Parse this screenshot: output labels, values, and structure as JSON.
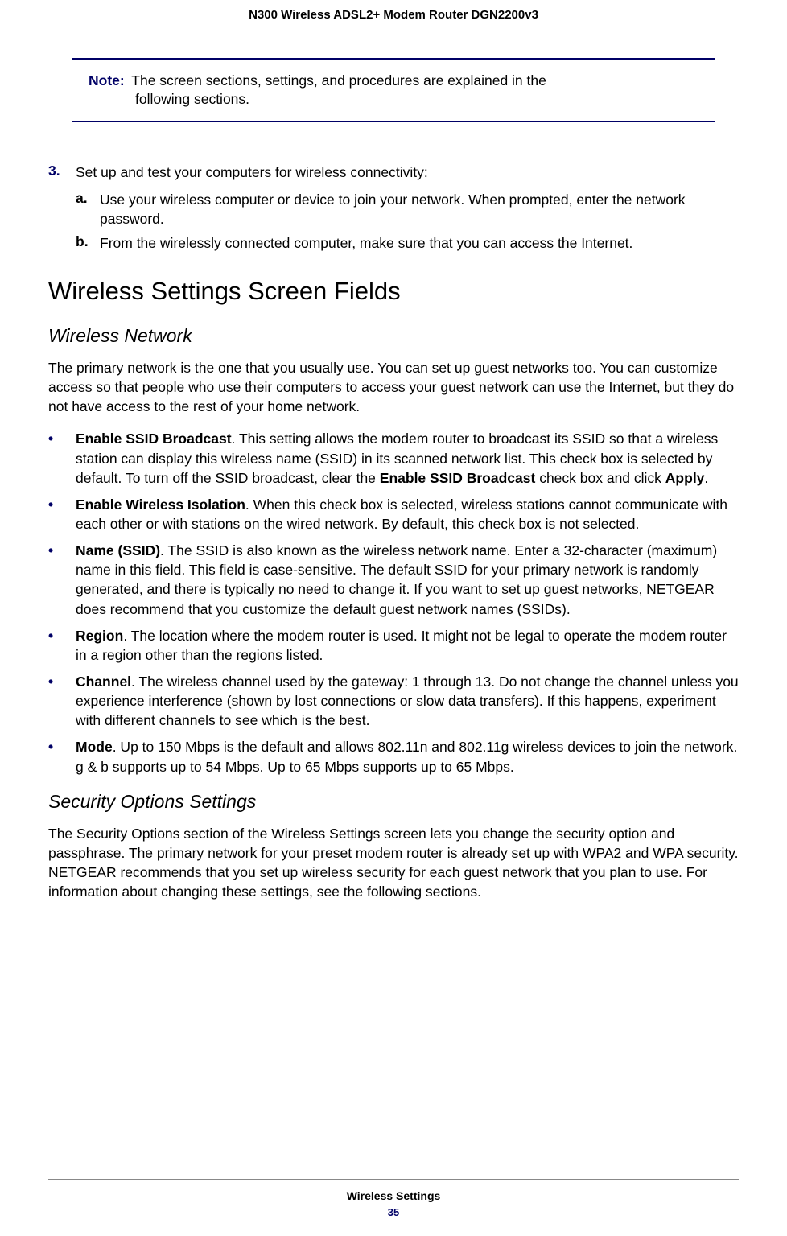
{
  "header": {
    "title": "N300 Wireless ADSL2+ Modem Router DGN2200v3"
  },
  "note": {
    "label": "Note:",
    "line1": "The screen sections, settings, and procedures are explained in the",
    "line2": "following sections."
  },
  "step3": {
    "number": "3.",
    "text": "Set up and test your computers for wireless connectivity:",
    "sub_a": {
      "label": "a.",
      "text": "Use your wireless computer or device to join your network. When prompted, enter the network password."
    },
    "sub_b": {
      "label": "b.",
      "text": "From the wirelessly connected computer, make sure that you can access the Internet."
    }
  },
  "h1": "Wireless Settings Screen Fields",
  "wireless_network": {
    "heading": "Wireless Network",
    "intro": "The primary network is the one that you usually use. You can set up guest networks too. You can customize access so that people who use their computers to access your guest network can use the Internet, but they do not have access to the rest of your home network.",
    "bullets": {
      "ssid_broadcast": {
        "bold1": "Enable SSID Broadcast",
        "text1": ". This setting allows the modem router to broadcast its SSID so that a wireless station can display this wireless name (SSID) in its scanned network list. This check box is selected by default. To turn off the SSID broadcast, clear the ",
        "bold2": "Enable SSID Broadcast",
        "text2": " check box and click ",
        "bold3": "Apply",
        "text3": "."
      },
      "wireless_isolation": {
        "bold": "Enable Wireless Isolation",
        "text": ". When this check box is selected, wireless stations cannot communicate with each other or with stations on the wired network. By default, this check box is not selected."
      },
      "name_ssid": {
        "bold": "Name (SSID)",
        "text": ". The SSID is also known as the wireless network name. Enter a 32-character (maximum) name in this field. This field is case-sensitive. The default SSID for your primary network is randomly generated, and there is typically no need to change it. If you want to set up guest networks, NETGEAR does recommend that you customize the default guest network names (SSIDs)."
      },
      "region": {
        "bold": "Region",
        "text": ". The location where the modem router is used. It might not be legal to operate the modem router in a region other than the regions listed."
      },
      "channel": {
        "bold": "Channel",
        "text": ". The wireless channel used by the gateway: 1 through 13. Do not change the channel unless you experience interference (shown by lost connections or slow data transfers). If this happens, experiment with different channels to see which is the best."
      },
      "mode": {
        "bold": "Mode",
        "text": ". Up to 150 Mbps is the default and allows 802.11n and 802.11g wireless devices to join the network. g & b supports up to 54 Mbps. Up to 65 Mbps supports up to 65 Mbps."
      }
    }
  },
  "security_options": {
    "heading": "Security Options Settings",
    "text": "The Security Options section of the Wireless Settings screen lets you change the security option and passphrase. The primary network for your preset modem router is already set up with WPA2 and WPA security. NETGEAR recommends that you set up wireless security for each guest network that you plan to use. For information about changing these settings, see the following sections."
  },
  "footer": {
    "label": "Wireless Settings",
    "page": "35"
  },
  "bullet_marker": "•"
}
